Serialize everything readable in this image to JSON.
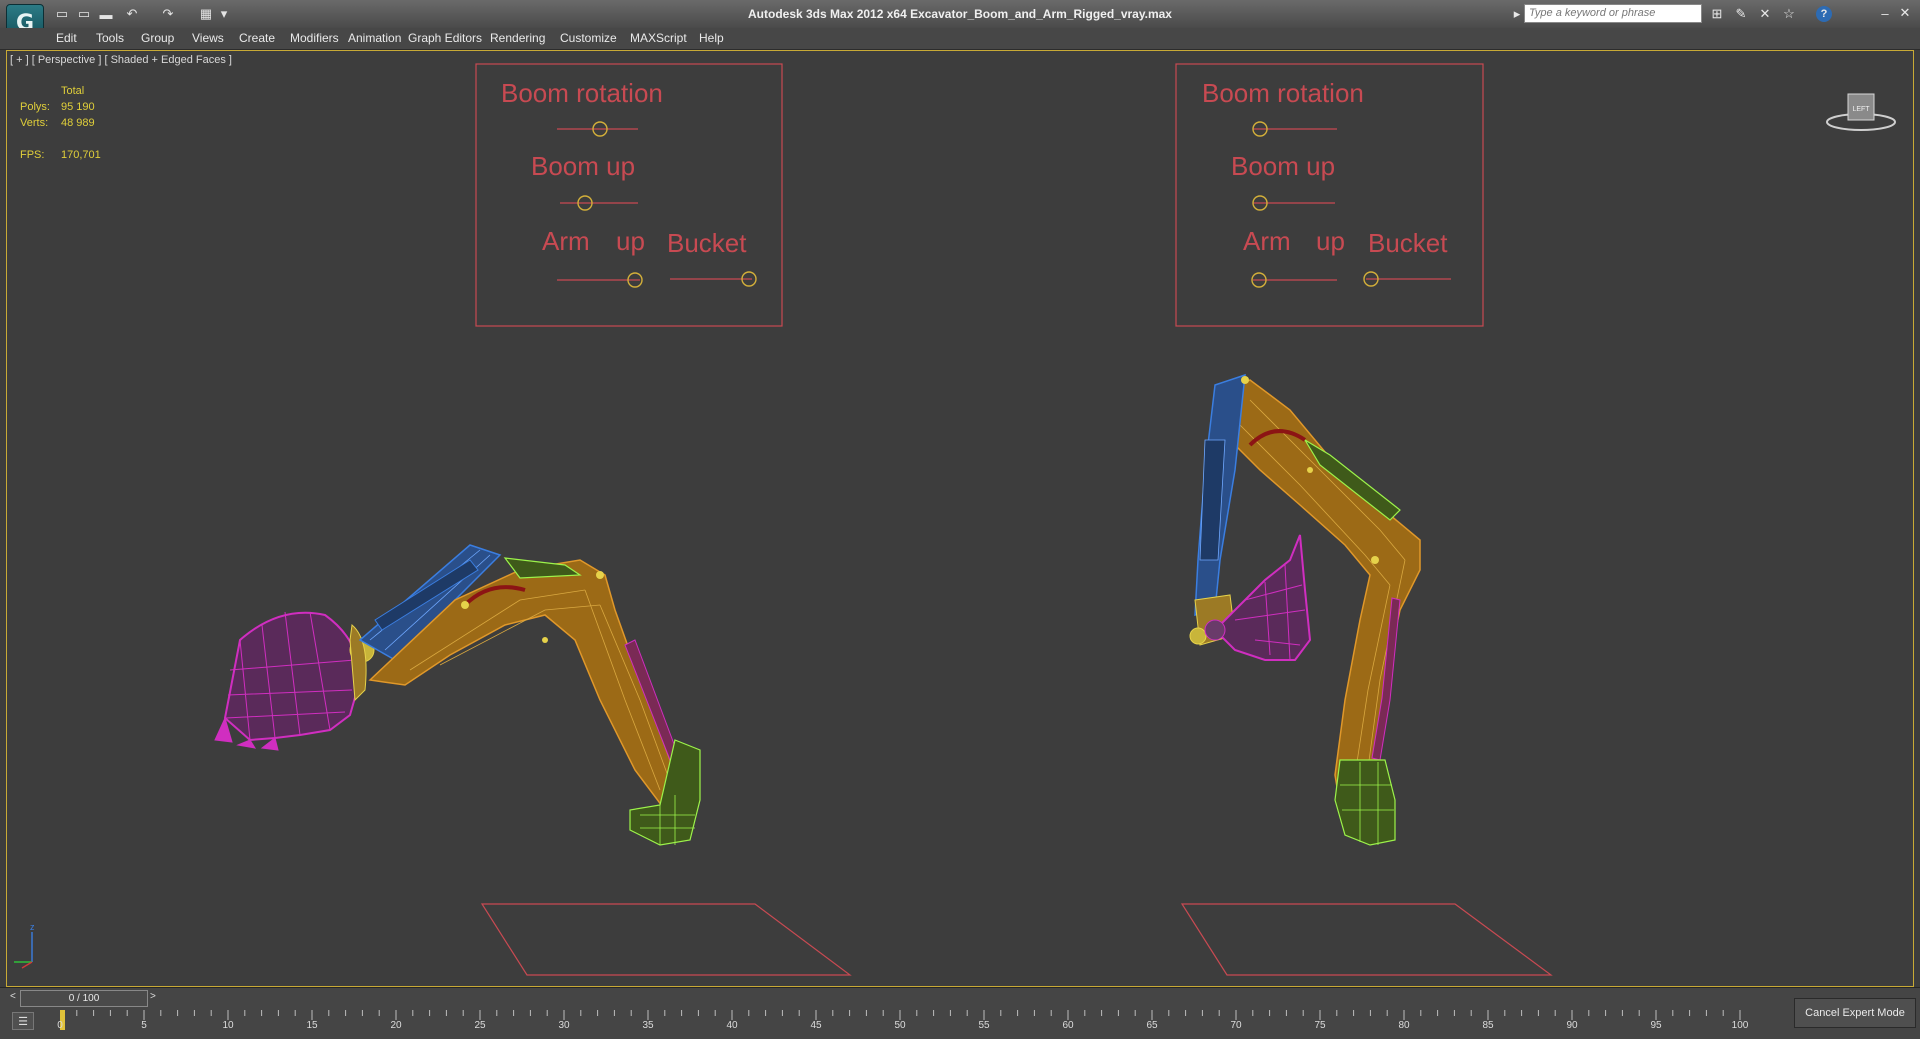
{
  "title_bar": {
    "app_logo": "G",
    "window_title": "Autodesk 3ds Max  2012 x64     Excavator_Boom_and_Arm_Rigged_vray.max",
    "search_placeholder": "Type a keyword or phrase",
    "help_icon": "?"
  },
  "quick_access": {
    "new": "▭",
    "open": "▭",
    "save": "▬",
    "undo": "↶",
    "redo": "↷",
    "project": "▦",
    "more": "▾"
  },
  "menu": {
    "items": [
      "Edit",
      "Tools",
      "Group",
      "Views",
      "Create",
      "Modifiers",
      "Animation",
      "Graph Editors",
      "Rendering",
      "Customize",
      "MAXScript",
      "Help"
    ]
  },
  "viewport": {
    "label": "[ + ] [ Perspective ] [ Shaded + Edged Faces ]",
    "stats": {
      "header": "Total",
      "polys_label": "Polys:",
      "polys_value": "95 190",
      "verts_label": "Verts:",
      "verts_value": "48 989",
      "fps_label": "FPS:",
      "fps_value": "170,701"
    },
    "viewcube_label": "LEFT",
    "axis_z": "z"
  },
  "rig_controls": {
    "boom_rotation": "Boom rotation",
    "boom_up": "Boom up",
    "arm": "Arm",
    "up": "up",
    "bucket": "Bucket"
  },
  "timeline": {
    "frame_display": "0 / 100",
    "prev": "<",
    "next": ">",
    "ticks": [
      "0",
      "5",
      "10",
      "15",
      "20",
      "25",
      "30",
      "35",
      "40",
      "45",
      "50",
      "55",
      "60",
      "65",
      "70",
      "75",
      "80",
      "85",
      "90",
      "95",
      "100"
    ],
    "cancel_expert_mode": "Cancel Expert Mode"
  },
  "colors": {
    "control_red": "#c84a52",
    "viewport_bg": "#3d3d3d",
    "active_border": "#c8aa36",
    "stats_yellow": "#e0cf3a",
    "wire_orange": "#c98a1e",
    "wire_blue": "#2f6fc9",
    "wire_magenta": "#d02ec0",
    "wire_green": "#9cf34a"
  }
}
